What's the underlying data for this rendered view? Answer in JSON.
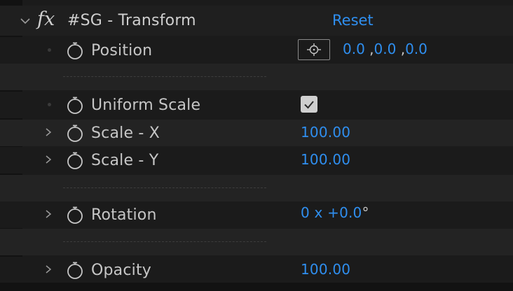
{
  "effect": {
    "name": "#SG - Transform",
    "reset_label": "Reset"
  },
  "properties": [
    {
      "id": "position",
      "label": "Position",
      "value_parts": [
        "0.0",
        "0.0",
        "0.0"
      ]
    },
    {
      "id": "uniform-scale",
      "label": "Uniform Scale",
      "checked": true
    },
    {
      "id": "scale-x",
      "label": "Scale - X",
      "value": "100.00"
    },
    {
      "id": "scale-y",
      "label": "Scale - Y",
      "value": "100.00"
    },
    {
      "id": "rotation",
      "label": "Rotation",
      "value_revs": "0",
      "value_x": "x",
      "value_deg": "+0.0",
      "value_unit": "°"
    },
    {
      "id": "opacity",
      "label": "Opacity",
      "value": "100.00"
    }
  ],
  "colors": {
    "accent": "#2f8ff0",
    "panel_bg": "#1b1b1b",
    "row_alt_bg": "#232323",
    "text": "#c6c6c6"
  },
  "icons": {
    "effect": "fx-icon",
    "stopwatch": "stopwatch-icon",
    "twirl": "chevron-right-icon",
    "expand": "chevron-down-icon",
    "target": "crosshair-icon",
    "check": "checkmark-icon"
  }
}
